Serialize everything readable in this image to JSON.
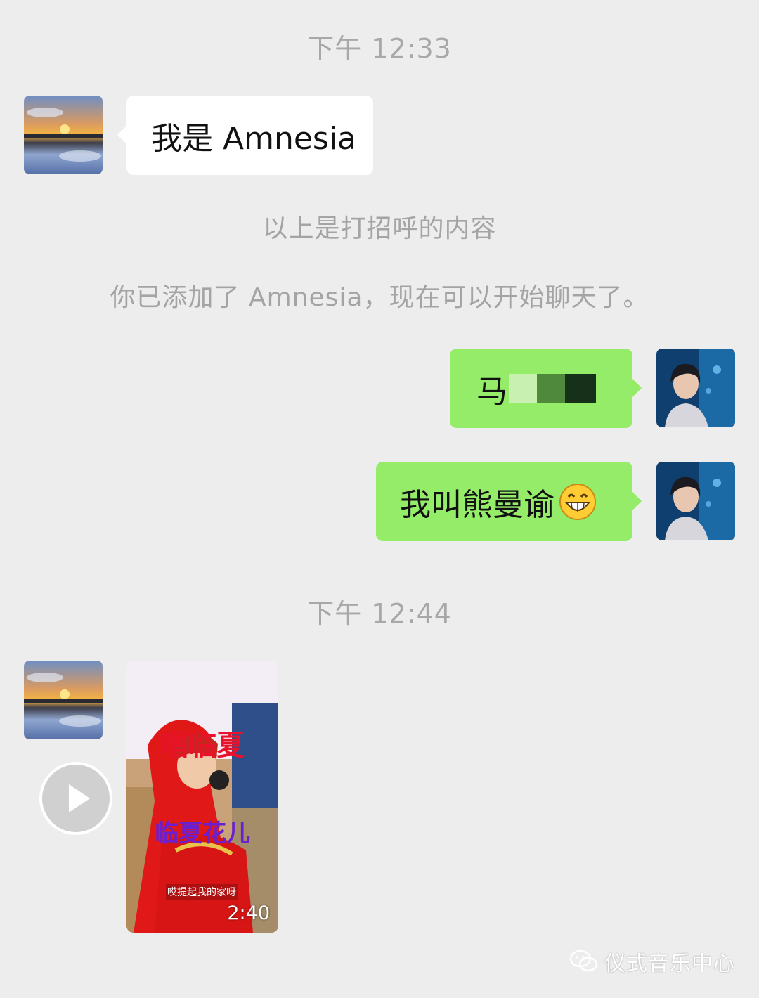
{
  "timestamps": [
    "下午 12:33",
    "下午 12:44"
  ],
  "messages": {
    "greeting": "我是 Amnesia",
    "system_greeting_note": "以上是打招呼的内容",
    "system_added": "你已添加了 Amnesia，现在可以开始聊天了。",
    "out_1_visible": "马",
    "out_2": "我叫熊曼谕"
  },
  "video": {
    "duration": "2:40",
    "title_top": "唱临夏",
    "title_bottom": "临夏花儿",
    "caption": "哎提起我的家呀"
  },
  "watermark": "仪式音乐中心",
  "colors": {
    "background": "#ededed",
    "bubble_out": "#95ec69",
    "bubble_in": "#ffffff",
    "timestamp": "#a8a8a8"
  },
  "icons": [
    "play-icon",
    "grinning-emoji-icon",
    "wechat-logo-icon"
  ]
}
